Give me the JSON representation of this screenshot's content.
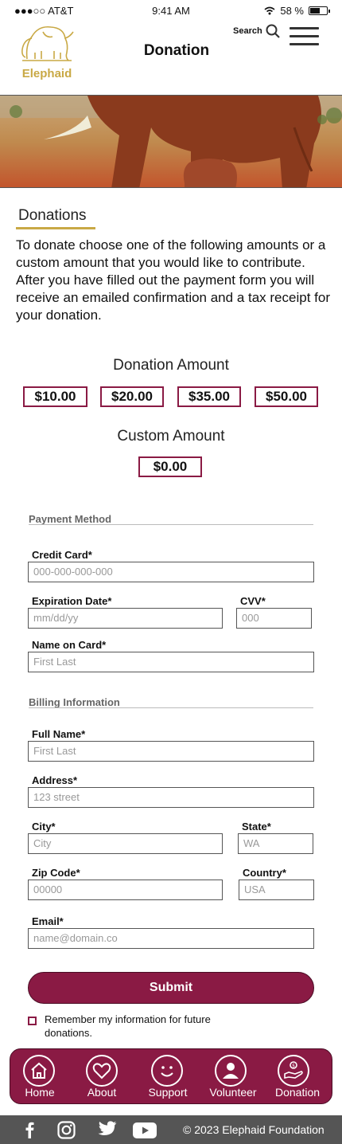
{
  "status_bar": {
    "carrier": "●●●○○ AT&T",
    "time": "9:41 AM",
    "battery": "58 %",
    "battery_level": 0.58
  },
  "header": {
    "logo_text": "Elephaid",
    "title": "Donation",
    "search_label": "Search",
    "brand_color": "#c9a945",
    "accent_color": "#8a1a44"
  },
  "donations": {
    "title": "Donations",
    "intro": "To donate choose one of the following amounts or a custom amount that you would like to contribute. After you have filled out the payment form you will receive an emailed confirmation and a tax receipt for your donation.",
    "amount_heading": "Donation Amount",
    "amounts": [
      "$10.00",
      "$20.00",
      "$35.00",
      "$50.00"
    ],
    "custom_heading": "Custom Amount",
    "custom_amount": "$0.00"
  },
  "payment": {
    "title": "Payment Method",
    "credit_card_label": "Credit Card*",
    "credit_card_placeholder": "000-000-000-000",
    "expiration_label": "Expiration Date*",
    "expiration_placeholder": "mm/dd/yy",
    "cvv_label": "CVV*",
    "cvv_placeholder": "000",
    "name_on_card_label": "Name on Card*",
    "name_on_card_placeholder": "First Last"
  },
  "billing": {
    "title": "Billing Information",
    "full_name_label": "Full Name*",
    "full_name_placeholder": "First Last",
    "address_label": "Address*",
    "address_placeholder": "123 street",
    "city_label": "City*",
    "city_placeholder": "City",
    "state_label": "State*",
    "state_placeholder": "WA",
    "zip_label": "Zip Code*",
    "zip_placeholder": "00000",
    "country_label": "Country*",
    "country_placeholder": "USA",
    "email_label": "Email*",
    "email_placeholder": "name@domain.co\nm"
  },
  "actions": {
    "submit_label": "Submit",
    "remember_label": "Remember my information for future donations."
  },
  "bottom_nav": {
    "items": [
      {
        "label": "Home",
        "icon": "home-icon"
      },
      {
        "label": "About",
        "icon": "heart-icon"
      },
      {
        "label": "Support",
        "icon": "smile-icon"
      },
      {
        "label": "Volunteer",
        "icon": "person-icon"
      },
      {
        "label": "Donation",
        "icon": "donate-hand-icon"
      }
    ]
  },
  "footer": {
    "social_icons": [
      "facebook-icon",
      "instagram-icon",
      "twitter-icon",
      "youtube-icon"
    ],
    "copyright": "© 2023 Elephaid Foundation"
  }
}
